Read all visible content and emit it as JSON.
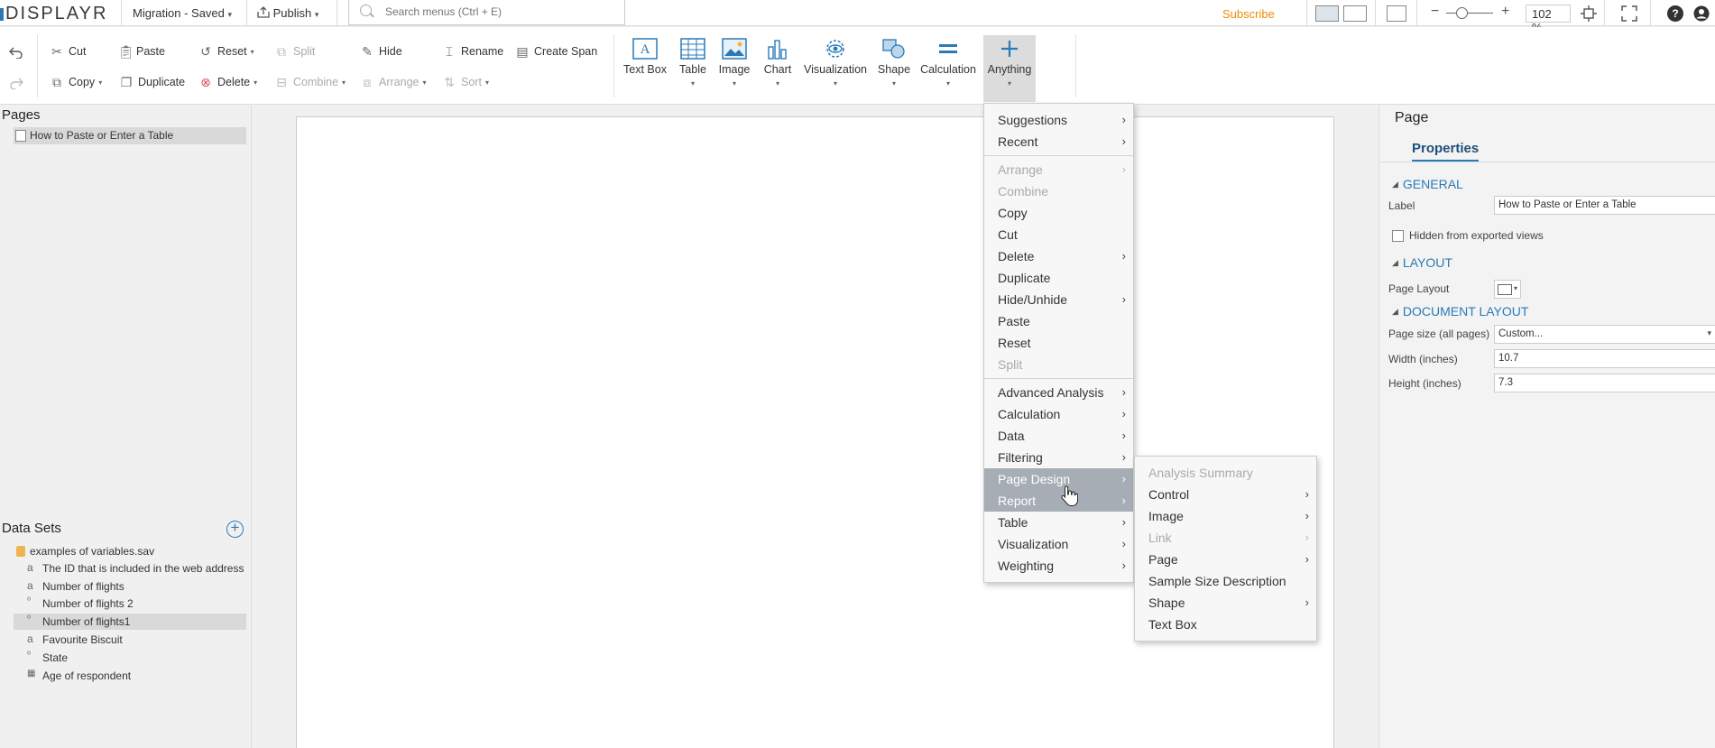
{
  "app": {
    "logo": "DISPLAYR",
    "doc_status": "Migration - Saved",
    "publish_label": "Publish",
    "search_placeholder": "Search menus (Ctrl + E)",
    "subscribe_label": "Subscribe",
    "zoom_value": "102 %",
    "help_icon": "help-icon",
    "user_icon": "user-icon",
    "brand_color": "#2a7ab8",
    "accent_color": "#f08c00"
  },
  "ribbon": {
    "row1": [
      "Cut",
      "Paste",
      "Reset",
      "Split",
      "Hide",
      "Rename",
      "Create Span"
    ],
    "row2": [
      "Copy",
      "Duplicate",
      "Delete",
      "Combine",
      "Arrange",
      "Sort"
    ],
    "cut": "Cut",
    "paste": "Paste",
    "reset": "Reset",
    "split": "Split",
    "hide": "Hide",
    "rename": "Rename",
    "create_span": "Create Span",
    "copy": "Copy",
    "duplicate": "Duplicate",
    "delete": "Delete",
    "combine": "Combine",
    "arrange": "Arrange",
    "sort": "Sort",
    "insert": {
      "text_box": "Text Box",
      "table": "Table",
      "image": "Image",
      "chart": "Chart",
      "visualization": "Visualization",
      "shape": "Shape",
      "calculation": "Calculation",
      "anything": "Anything"
    }
  },
  "pages_panel": {
    "title": "Pages",
    "items": [
      "How to Paste or Enter a Table"
    ]
  },
  "datasets_panel": {
    "title": "Data Sets",
    "file": "examples of variables.sav",
    "variables": [
      {
        "label": "The ID that is included in the web address",
        "icon": "a"
      },
      {
        "label": "Number of flights",
        "icon": "a"
      },
      {
        "label": "Number of flights 2",
        "icon": "o"
      },
      {
        "label": "Number of flights1",
        "icon": "o"
      },
      {
        "label": "Favourite Biscuit",
        "icon": "a"
      },
      {
        "label": "State",
        "icon": "o"
      },
      {
        "label": "Age of respondent",
        "icon": "grid"
      }
    ]
  },
  "menu": {
    "items": [
      {
        "label": "Suggestions",
        "sub": true,
        "disabled": false
      },
      {
        "label": "Recent",
        "sub": true,
        "disabled": false
      },
      {
        "label": "Arrange",
        "sub": true,
        "disabled": true
      },
      {
        "label": "Combine",
        "sub": false,
        "disabled": true
      },
      {
        "label": "Copy",
        "sub": false,
        "disabled": false
      },
      {
        "label": "Cut",
        "sub": false,
        "disabled": false
      },
      {
        "label": "Delete",
        "sub": true,
        "disabled": false
      },
      {
        "label": "Duplicate",
        "sub": false,
        "disabled": false
      },
      {
        "label": "Hide/Unhide",
        "sub": true,
        "disabled": false
      },
      {
        "label": "Paste",
        "sub": false,
        "disabled": false
      },
      {
        "label": "Reset",
        "sub": false,
        "disabled": false
      },
      {
        "label": "Split",
        "sub": false,
        "disabled": true
      },
      {
        "label": "Advanced Analysis",
        "sub": true,
        "disabled": false
      },
      {
        "label": "Calculation",
        "sub": true,
        "disabled": false
      },
      {
        "label": "Data",
        "sub": true,
        "disabled": false
      },
      {
        "label": "Filtering",
        "sub": true,
        "disabled": false
      },
      {
        "label": "Page Design",
        "sub": true,
        "disabled": false,
        "highlight": true
      },
      {
        "label": "Report",
        "sub": true,
        "disabled": false,
        "highlight": true
      },
      {
        "label": "Table",
        "sub": true,
        "disabled": false
      },
      {
        "label": "Visualization",
        "sub": true,
        "disabled": false
      },
      {
        "label": "Weighting",
        "sub": true,
        "disabled": false
      }
    ]
  },
  "submenu": {
    "items": [
      {
        "label": "Analysis Summary",
        "sub": false,
        "disabled": true
      },
      {
        "label": "Control",
        "sub": true,
        "disabled": false
      },
      {
        "label": "Image",
        "sub": true,
        "disabled": false
      },
      {
        "label": "Link",
        "sub": true,
        "disabled": true
      },
      {
        "label": "Page",
        "sub": true,
        "disabled": false
      },
      {
        "label": "Sample Size Description",
        "sub": false,
        "disabled": false
      },
      {
        "label": "Shape",
        "sub": true,
        "disabled": false
      },
      {
        "label": "Text Box",
        "sub": false,
        "disabled": false
      }
    ]
  },
  "properties": {
    "title": "Page",
    "tab": "Properties",
    "general": "GENERAL",
    "label_label": "Label",
    "label_value": "How to Paste or Enter a Table",
    "hidden_label": "Hidden from exported views",
    "layout": "LAYOUT",
    "page_layout_label": "Page Layout",
    "document_layout": "DOCUMENT LAYOUT",
    "page_size_label": "Page size (all pages)",
    "page_size_value": "Custom...",
    "width_label": "Width (inches)",
    "width_value": "10.7",
    "height_label": "Height (inches)",
    "height_value": "7.3"
  }
}
